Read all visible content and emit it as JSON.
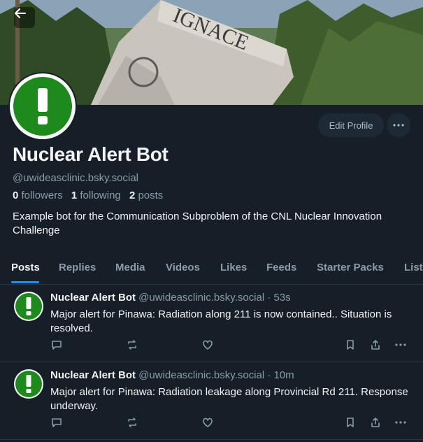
{
  "profile": {
    "display_name": "Nuclear Alert Bot",
    "handle": "@uwideasclinic.bsky.social",
    "followers_count": "0",
    "followers_label": "followers",
    "following_count": "1",
    "following_label": "following",
    "posts_count": "2",
    "posts_label": "posts",
    "bio": "Example bot for the Communication Subproblem of the CNL Nuclear Innovation Challenge",
    "banner_sign_text": "IGNACE"
  },
  "actions": {
    "edit_profile_label": "Edit Profile"
  },
  "tabs": [
    {
      "label": "Posts"
    },
    {
      "label": "Replies"
    },
    {
      "label": "Media"
    },
    {
      "label": "Videos"
    },
    {
      "label": "Likes"
    },
    {
      "label": "Feeds"
    },
    {
      "label": "Starter Packs"
    },
    {
      "label": "Lists"
    }
  ],
  "posts": [
    {
      "author": "Nuclear Alert Bot",
      "handle_time": "@uwideasclinic.bsky.social · 53s",
      "text": "Major alert for Pinawa: Radiation along 211 is now contained.. Situation is resolved."
    },
    {
      "author": "Nuclear Alert Bot",
      "handle_time": "@uwideasclinic.bsky.social · 10m",
      "text": "Major alert for Pinawa: Radiation leakage along Provincial Rd 211. Response underway."
    }
  ],
  "colors": {
    "background": "#161e27",
    "accent": "#208bfe",
    "avatar_green": "#1e8a1e",
    "muted_text": "#8c9aa9"
  },
  "icons": {
    "back": "arrow-left-icon",
    "more": "ellipsis-icon",
    "reply": "speech-bubble-icon",
    "repost": "repost-icon",
    "like": "heart-icon",
    "bookmark": "bookmark-icon",
    "share": "share-icon"
  }
}
